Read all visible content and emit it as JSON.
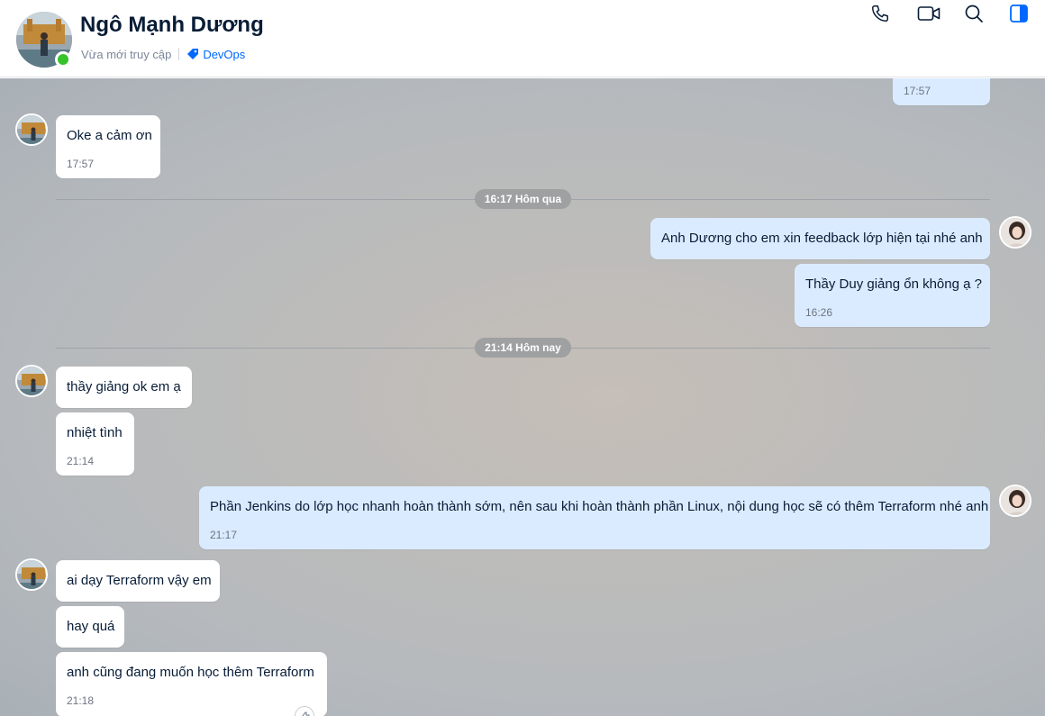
{
  "header": {
    "contact_name": "Ngô Mạnh Dương",
    "last_seen": "Vừa mới truy cập",
    "tag": "DevOps",
    "icons": [
      "phone-icon",
      "video-call-icon",
      "search-icon",
      "sidebar-toggle-icon"
    ]
  },
  "colors": {
    "accent": "#0068ff",
    "online": "#36c22b",
    "outgoing_bubble": "#dbebff",
    "incoming_bubble": "#ffffff"
  },
  "messages": [
    {
      "dir": "out",
      "text": "",
      "time": "17:57"
    },
    {
      "dir": "in",
      "text": "Oke a cảm ơn",
      "time": "17:57"
    },
    {
      "dir": "out",
      "text": "Anh Dương cho em xin feedback lớp hiện tại nhé anh",
      "time": ""
    },
    {
      "dir": "out",
      "text": "Thầy Duy giảng ổn không ạ ?",
      "time": "16:26"
    },
    {
      "dir": "in",
      "text": "thầy giảng ok em ạ",
      "time": ""
    },
    {
      "dir": "in",
      "text": "nhiệt tình",
      "time": "21:14"
    },
    {
      "dir": "out",
      "text": "Phần Jenkins do lớp học nhanh hoàn thành sớm, nên sau khi hoàn thành phần Linux, nội dung học sẽ có thêm Terraform nhé anh",
      "time": "21:17"
    },
    {
      "dir": "in",
      "text": "ai dạy Terraform vậy em",
      "time": ""
    },
    {
      "dir": "in",
      "text": "hay quá",
      "time": ""
    },
    {
      "dir": "in",
      "text": "anh cũng đang muốn học thêm Terraform",
      "time": "21:18"
    }
  ],
  "dividers": [
    "16:17 Hôm qua",
    "21:14 Hôm nay"
  ]
}
